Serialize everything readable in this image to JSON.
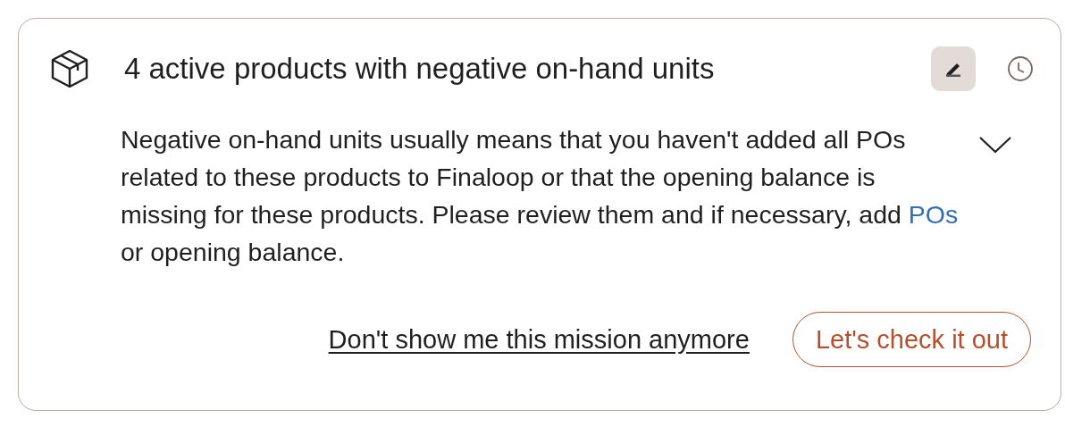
{
  "mission": {
    "title": "4 active products with negative on-hand units",
    "edit_selected": true,
    "expanded": true,
    "description": "Negative on-hand units usually means that you haven't added all POs related to these products to Finaloop or that the opening balance is missing for these products. Please review them and if necessary, add",
    "link": "POs",
    "description_end": "or opening balance.",
    "dismiss": "Don't show me this mission anymore",
    "action": "Let's check it out"
  }
}
